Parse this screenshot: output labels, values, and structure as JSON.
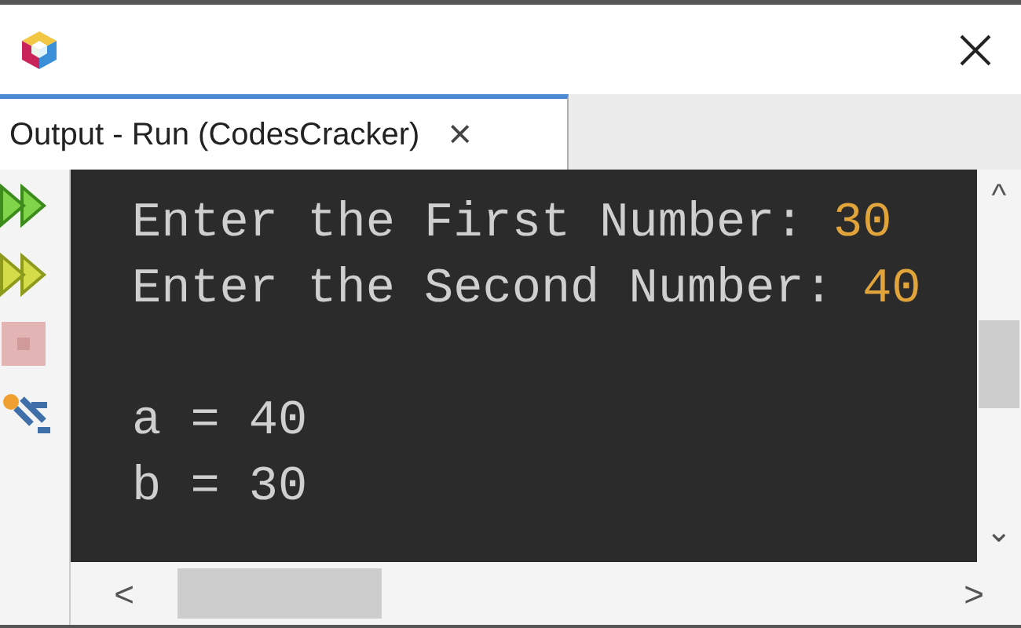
{
  "tab": {
    "label": "Output - Run (CodesCracker)",
    "selected": true,
    "close": "×"
  },
  "console_lines": [
    {
      "kind": "prompt",
      "text": "Enter the First Number: ",
      "input": "30"
    },
    {
      "kind": "prompt",
      "text": "Enter the Second Number: ",
      "input": "40"
    },
    {
      "kind": "blank"
    },
    {
      "kind": "output",
      "text": "a = 40"
    },
    {
      "kind": "output",
      "text": "b = 30"
    }
  ],
  "scrollbars": {
    "up": "^",
    "down": "⌄",
    "left": "<",
    "right": ">"
  }
}
